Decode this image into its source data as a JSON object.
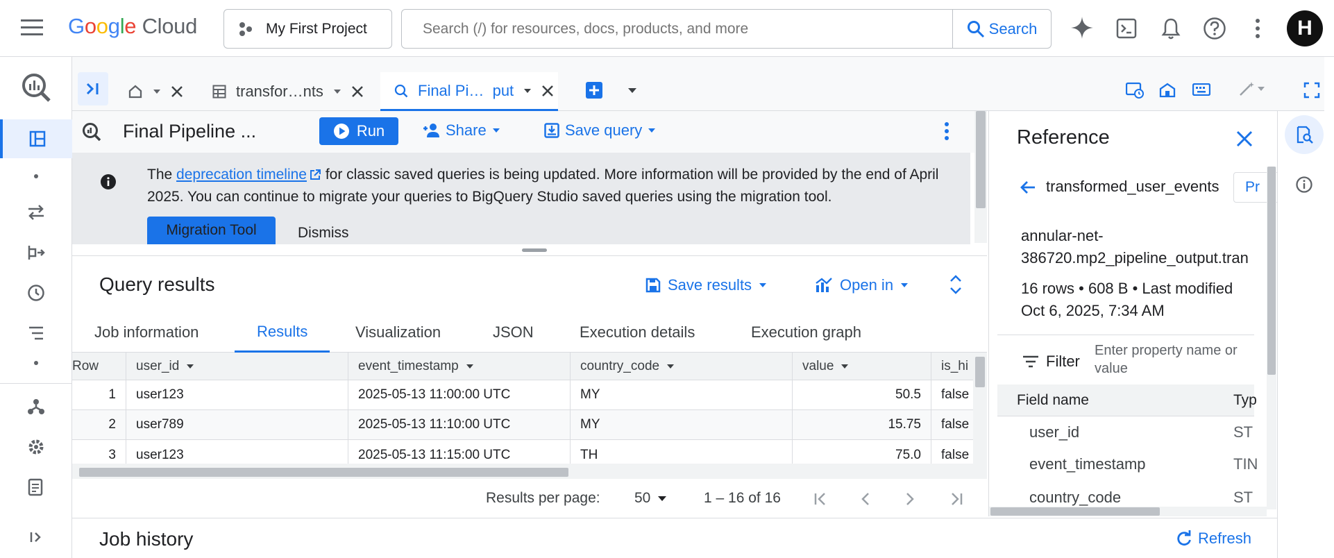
{
  "topbar": {
    "logo_google": "Google",
    "logo_cloud": "Cloud",
    "project": "My First Project",
    "search_placeholder": "Search (/) for resources, docs, products, and more",
    "search_button": "Search",
    "avatar_letter": "H"
  },
  "tabs": [
    {
      "label": "transfor…nts"
    },
    {
      "label": "Final Pi…  put"
    }
  ],
  "editor": {
    "title": "Final Pipeline ...",
    "run": "Run",
    "share": "Share",
    "save_query": "Save query"
  },
  "banner": {
    "text_before": "The ",
    "link": "deprecation timeline",
    "text_after": " for classic saved queries is being updated. More information will be provided by the end of April 2025. You can continue to migrate your queries to BigQuery Studio saved queries using the migration tool.",
    "migration_tool": "Migration Tool",
    "dismiss": "Dismiss"
  },
  "results": {
    "title": "Query results",
    "save_results": "Save results",
    "open_in": "Open in",
    "subtabs": [
      "Job information",
      "Results",
      "Visualization",
      "JSON",
      "Execution details",
      "Execution graph"
    ],
    "columns": [
      "Row",
      "user_id",
      "event_timestamp",
      "country_code",
      "value",
      "is_hi"
    ],
    "rows": [
      [
        "1",
        "user123",
        "2025-05-13 11:00:00 UTC",
        "MY",
        "50.5",
        "false"
      ],
      [
        "2",
        "user789",
        "2025-05-13 11:10:00 UTC",
        "MY",
        "15.75",
        "false"
      ],
      [
        "3",
        "user123",
        "2025-05-13 11:15:00 UTC",
        "TH",
        "75.0",
        "false"
      ]
    ],
    "per_page_label": "Results per page:",
    "per_page_value": "50",
    "range": "1 – 16 of 16"
  },
  "job_history": {
    "title": "Job history",
    "refresh": "Refresh"
  },
  "reference": {
    "title": "Reference",
    "table_name": "transformed_user_events",
    "preview_btn": "Pr",
    "full_name_1": "annular-net-",
    "full_name_2": "386720.mp2_pipeline_output.tran",
    "stats_1": "16 rows • 608 B • Last modified",
    "stats_2": "Oct 6, 2025, 7:34 AM",
    "filter_label": "Filter",
    "filter_placeholder": "Enter property name or value",
    "col_field": "Field name",
    "col_type": "Typ",
    "fields": [
      {
        "name": "user_id",
        "type": "ST"
      },
      {
        "name": "event_timestamp",
        "type": "TIN"
      },
      {
        "name": "country_code",
        "type": "ST"
      }
    ]
  },
  "colors": {
    "accent": "#1a73e8",
    "banner_bg": "#e8eaed",
    "header_bg": "#f1f3f4"
  }
}
